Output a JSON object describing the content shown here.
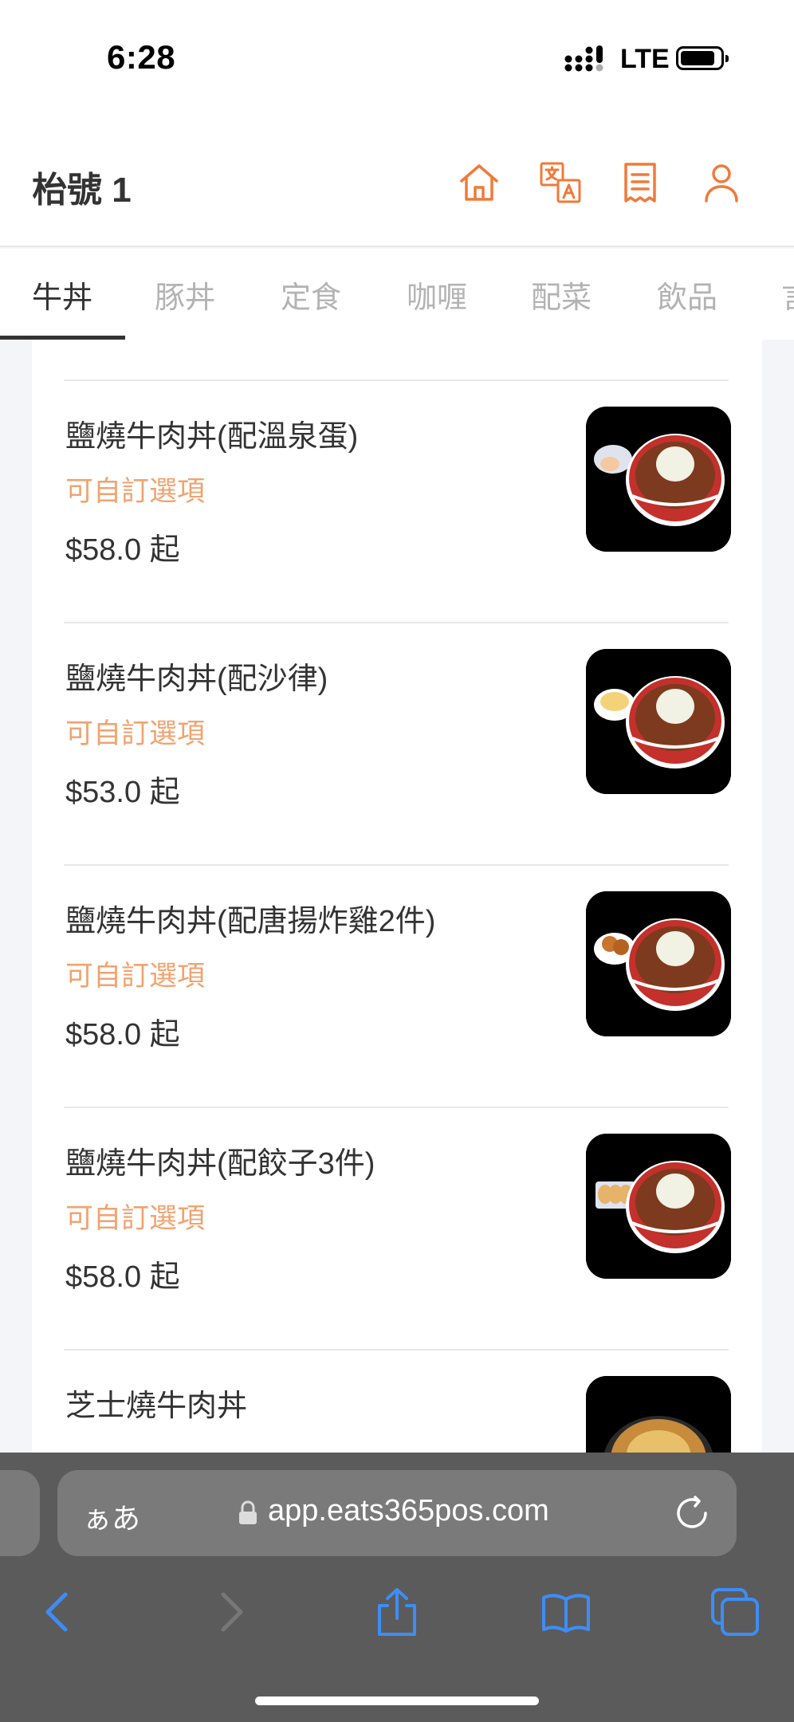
{
  "status_bar": {
    "time": "6:28",
    "network": "LTE"
  },
  "header": {
    "title": "枱號 1",
    "icons": [
      "home-icon",
      "translate-icon",
      "receipt-icon",
      "user-icon"
    ],
    "accent_color": "#f07a3a"
  },
  "tabs": [
    "牛丼",
    "豚丼",
    "定食",
    "咖喱",
    "配菜",
    "飲品",
    "言"
  ],
  "active_tab": "牛丼",
  "items": [
    {
      "name": "鹽燒牛肉丼(配溫泉蛋)",
      "note": "可自訂選項",
      "price": "$58.0 起"
    },
    {
      "name": "鹽燒牛肉丼(配沙律)",
      "note": "可自訂選項",
      "price": "$53.0 起"
    },
    {
      "name": "鹽燒牛肉丼(配唐揚炸雞2件)",
      "note": "可自訂選項",
      "price": "$58.0 起"
    },
    {
      "name": "鹽燒牛肉丼(配餃子3件)",
      "note": "可自訂選項",
      "price": "$58.0 起"
    },
    {
      "name": "芝士燒牛肉丼"
    }
  ],
  "browser": {
    "aa_label": "ぁあ",
    "url": "app.eats365pos.com",
    "toolbar_icons": [
      "back-icon",
      "forward-icon",
      "share-icon",
      "bookmarks-icon",
      "tabs-icon"
    ]
  }
}
